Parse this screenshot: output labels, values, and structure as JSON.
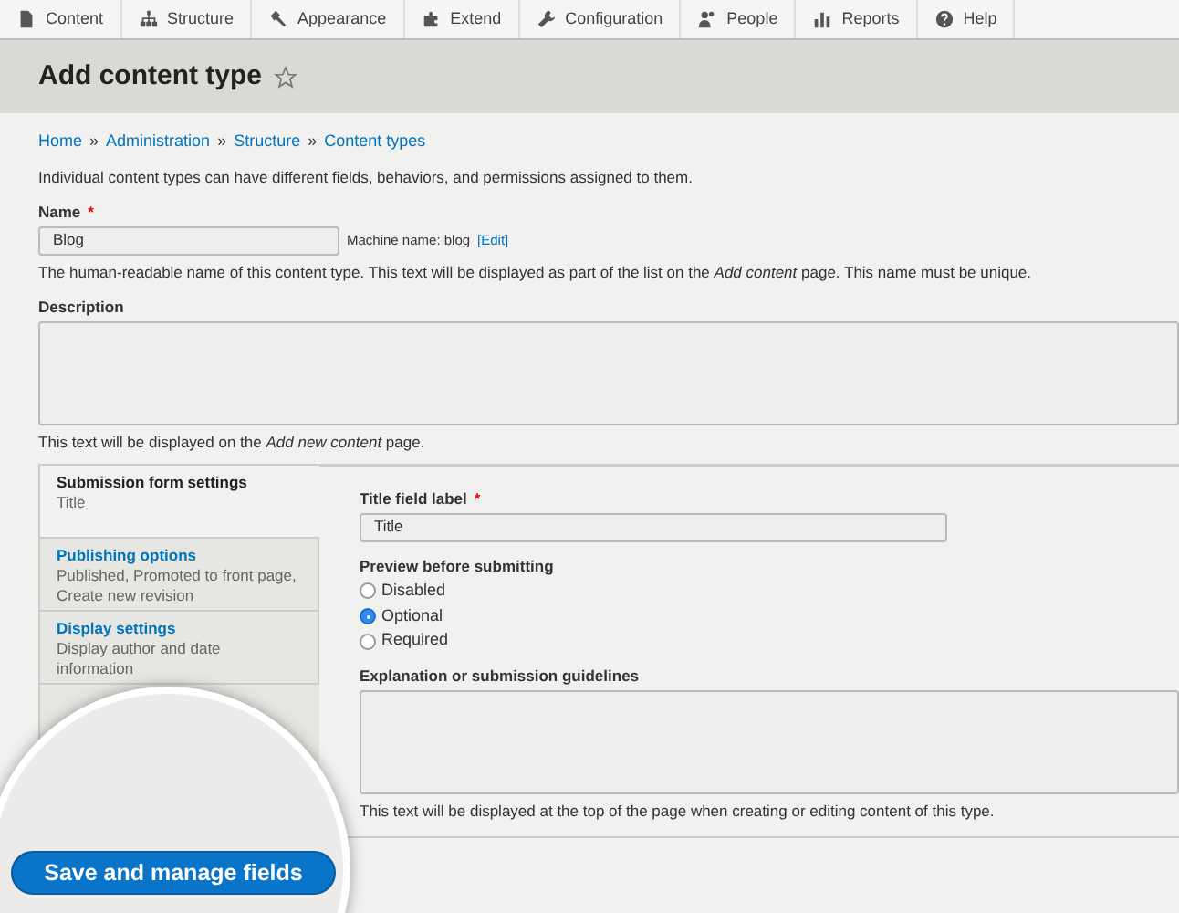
{
  "toolbar": [
    {
      "label": "Content"
    },
    {
      "label": "Structure"
    },
    {
      "label": "Appearance"
    },
    {
      "label": "Extend"
    },
    {
      "label": "Configuration"
    },
    {
      "label": "People"
    },
    {
      "label": "Reports"
    },
    {
      "label": "Help"
    }
  ],
  "page_title": "Add content type",
  "favorite": false,
  "breadcrumb": [
    "Home",
    "Administration",
    "Structure",
    "Content types"
  ],
  "breadcrumb_separator": "»",
  "intro": "Individual content types can have different fields, behaviors, and permissions assigned to them.",
  "name_field": {
    "label": "Name",
    "required_mark": "*",
    "value": "Blog",
    "machine_name": "Machine name: blog",
    "edit_link": "[Edit]",
    "help": "The human-readable name of this content type. This text will be displayed as part of the list on the *Add content* page. This name must be unique."
  },
  "description_field": {
    "label": "Description",
    "help": "This text will be displayed on the *Add new content* page."
  },
  "vertical_tabs": [
    {
      "title": "Submission form settings",
      "summary": "Title",
      "selected": true
    },
    {
      "title": "Publishing options",
      "summary": "Published, Promoted to front page, Create new revision",
      "selected": false
    },
    {
      "title": "Display settings",
      "summary": "Display author and date information",
      "selected": false
    }
  ],
  "title_field": {
    "label": "Title field label",
    "required_mark": "*",
    "value": "Title"
  },
  "preview": {
    "label": "Preview before submitting",
    "options": [
      {
        "label": "Disabled",
        "selected": false
      },
      {
        "label": "Optional",
        "selected": true
      },
      {
        "label": "Required",
        "selected": false
      }
    ]
  },
  "guidelines": {
    "label": "Explanation or submission guidelines",
    "help": "This text will be displayed at the top of the page when creating or editing content of this type."
  },
  "magnified_button": "Save and manage fields"
}
